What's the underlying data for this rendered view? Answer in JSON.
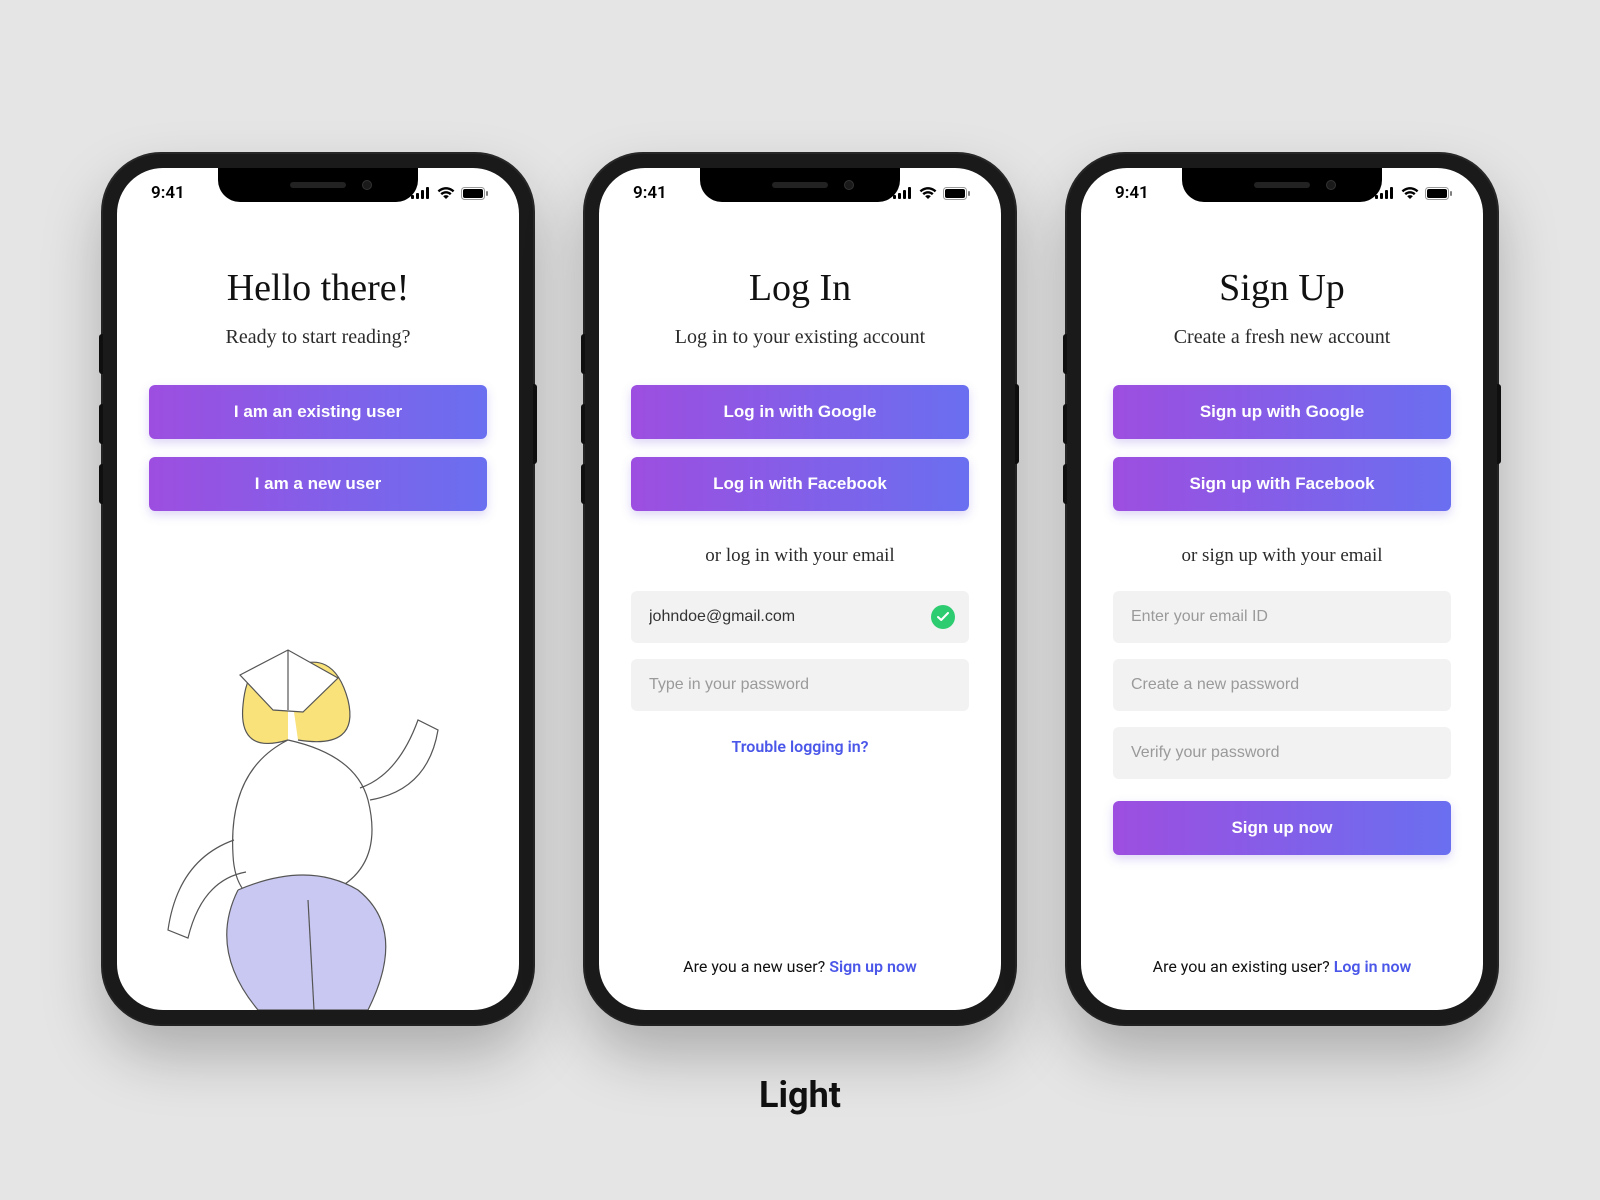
{
  "caption": "Light",
  "status": {
    "time": "9:41"
  },
  "colors": {
    "gradient_start": "#9d4ee0",
    "gradient_end": "#6a6ff0",
    "link": "#4b57e8",
    "input_bg": "#f2f2f2",
    "success": "#2ecc71"
  },
  "screens": {
    "welcome": {
      "title": "Hello there!",
      "subtitle": "Ready to start reading?",
      "existing_btn": "I am an existing user",
      "new_btn": "I am a new user"
    },
    "login": {
      "title": "Log In",
      "subtitle": "Log in to your existing account",
      "google_btn": "Log in with Google",
      "facebook_btn": "Log in with Facebook",
      "divider": "or log in with your email",
      "email_value": "johndoe@gmail.com",
      "password_placeholder": "Type in your password",
      "trouble_link": "Trouble logging in?",
      "footer_q": "Are you a new user? ",
      "footer_link": "Sign up now"
    },
    "signup": {
      "title": "Sign Up",
      "subtitle": "Create a fresh new account",
      "google_btn": "Sign up with Google",
      "facebook_btn": "Sign up with Facebook",
      "divider": "or sign up with your email",
      "email_placeholder": "Enter your email ID",
      "password_placeholder": "Create a new password",
      "verify_placeholder": "Verify your password",
      "submit_btn": "Sign up now",
      "footer_q": "Are you an existing user? ",
      "footer_link": "Log in now"
    }
  }
}
